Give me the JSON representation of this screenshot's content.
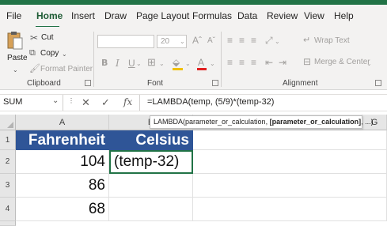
{
  "tabs": [
    "File",
    "Home",
    "Insert",
    "Draw",
    "Page Layout",
    "Formulas",
    "Data",
    "Review",
    "View",
    "Help"
  ],
  "active_tab": "Home",
  "ribbon": {
    "clipboard": {
      "paste": "Paste",
      "cut": "Cut",
      "copy": "Copy",
      "format_painter": "Format Painter",
      "label": "Clipboard"
    },
    "font": {
      "size": "20",
      "bold": "B",
      "italic": "I",
      "underline": "U",
      "grow": "A",
      "shrink": "A",
      "font_color_glyph": "A",
      "label": "Font"
    },
    "alignment": {
      "wrap_text": "Wrap Text",
      "merge_center": "Merge & Center",
      "label": "Alignment"
    }
  },
  "formula_bar": {
    "name_box": "SUM",
    "cancel": "✕",
    "enter": "✓",
    "fx": "fx",
    "formula": "=LAMBDA(temp, (5/9)*(temp-32)"
  },
  "tooltip": {
    "prefix": "LAMBDA(parameter_or_calculation, ",
    "bold": "[parameter_or_calculation]",
    "suffix": ", ...)"
  },
  "columns": [
    "A",
    "B",
    "G"
  ],
  "rows": [
    "1",
    "2",
    "3",
    "4"
  ],
  "cells": {
    "A1": "Fahrenheit",
    "B1": "Celsius",
    "A2": "104",
    "B2": "(temp-32)",
    "A3": "86",
    "A4": "68"
  },
  "colors": {
    "accent": "#217346",
    "header_fill": "#2f5597",
    "header_text": "#ffffff"
  }
}
